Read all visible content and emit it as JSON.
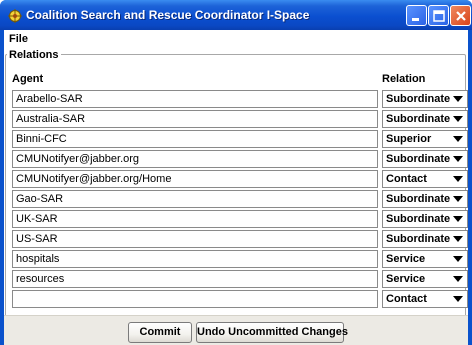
{
  "window": {
    "title": "Coalition Search and Rescue Coordinator I-Space",
    "titlebar_color": "#0b4fd0",
    "icons": {
      "app": "app-icon",
      "minimize": "minimize-icon",
      "maximize": "maximize-icon",
      "close": "close-icon"
    }
  },
  "menu": {
    "file": "File"
  },
  "relations": {
    "legend": "Relations",
    "col_agent": "Agent",
    "col_relation": "Relation",
    "rows": [
      {
        "agent": "Arabello-SAR",
        "relation": "Subordinate"
      },
      {
        "agent": "Australia-SAR",
        "relation": "Subordinate"
      },
      {
        "agent": "Binni-CFC",
        "relation": "Superior"
      },
      {
        "agent": "CMUNotifyer@jabber.org",
        "relation": "Subordinate"
      },
      {
        "agent": "CMUNotifyer@jabber.org/Home",
        "relation": "Contact"
      },
      {
        "agent": "Gao-SAR",
        "relation": "Subordinate"
      },
      {
        "agent": "UK-SAR",
        "relation": "Subordinate"
      },
      {
        "agent": "US-SAR",
        "relation": "Subordinate"
      },
      {
        "agent": "hospitals",
        "relation": "Service"
      },
      {
        "agent": "resources",
        "relation": "Service"
      },
      {
        "agent": "",
        "relation": "Contact"
      }
    ]
  },
  "buttons": {
    "commit": "Commit",
    "undo": "Undo Uncommitted Changes"
  }
}
